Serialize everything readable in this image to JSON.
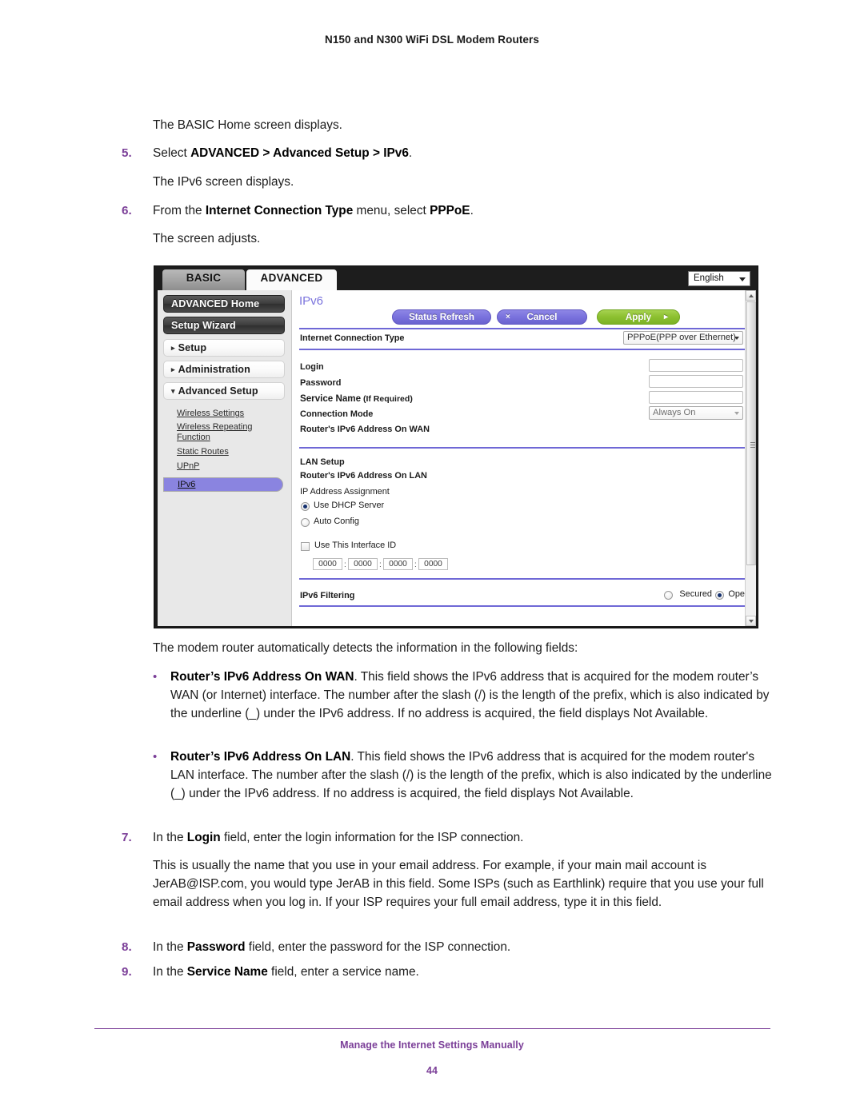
{
  "document": {
    "header_title": "N150 and N300 WiFi DSL Modem Routers",
    "footer_title": "Manage the Internet Settings Manually",
    "page_number": "44"
  },
  "body": {
    "intro_line": "The BASIC Home screen displays.",
    "step5": {
      "num": "5.",
      "pre": "Select ",
      "bold": "ADVANCED > Advanced Setup > IPv6",
      "post": "."
    },
    "after5": "The IPv6 screen displays.",
    "step6": {
      "num": "6.",
      "pre": "From the ",
      "bold": "Internet Connection Type",
      "mid": " menu, select ",
      "bold2": "PPPoE",
      "post": "."
    },
    "after6": "The screen adjusts.",
    "detects_line": "The modem router automatically detects the information in the following fields:",
    "bullet_wan": {
      "dot": "•",
      "bold": "Router’s IPv6 Address On WAN",
      "text": ". This field shows the IPv6 address that is acquired for the modem router’s WAN (or Internet) interface. The number after the slash (/) is the length of the prefix, which is also indicated by the underline (_) under the IPv6 address. If no address is acquired, the field displays Not Available."
    },
    "bullet_lan": {
      "dot": "•",
      "bold": "Router’s IPv6 Address On LAN",
      "text": ". This field shows the IPv6 address that is acquired for the modem router's LAN interface. The number after the slash (/) is the length of the prefix, which is also indicated by the underline (_) under the IPv6 address. If no address is acquired, the field displays Not Available."
    },
    "step7": {
      "num": "7.",
      "pre": "In the ",
      "bold": "Login",
      "post": " field, enter the login information for the ISP connection."
    },
    "after7": "This is usually the name that you use in your email address. For example, if your main mail account is JerAB@ISP.com, you would type JerAB in this field. Some ISPs (such as Earthlink) require that you use your full email address when you log in. If your ISP requires your full email address, type it in this field.",
    "step8": {
      "num": "8.",
      "pre": "In the ",
      "bold": "Password",
      "post": " field, enter the password for the ISP connection."
    },
    "step9": {
      "num": "9.",
      "pre": "In the ",
      "bold": "Service Name",
      "post": " field, enter a service name."
    }
  },
  "router_ui": {
    "tabs": {
      "basic": "BASIC",
      "advanced": "ADVANCED"
    },
    "language": {
      "value": "English"
    },
    "sidebar": {
      "advanced_home": "ADVANCED Home",
      "setup_wizard": "Setup Wizard",
      "setup": "Setup",
      "administration": "Administration",
      "advanced_setup": "Advanced Setup",
      "collapsed_arrow": "▸",
      "expanded_arrow": "▾",
      "links": [
        "Wireless Settings",
        "Wireless Repeating",
        "Function",
        "Static Routes",
        "UPnP"
      ],
      "selected_link": "IPv6"
    },
    "panel": {
      "title": "IPv6",
      "buttons": {
        "status_refresh": "Status Refresh",
        "cancel": "Cancel",
        "cancel_glyph": "×",
        "apply": "Apply",
        "apply_glyph": "▸"
      },
      "internet_connection_type_label": "Internet Connection Type",
      "internet_connection_type_value": "PPPoE(PPP over Ethernet)",
      "login_label": "Login",
      "login_value": "",
      "password_label": "Password",
      "password_value": "",
      "service_name_label": "Service Name",
      "service_name_suffix": " (If Required)",
      "service_name_value": "",
      "connection_mode_label": "Connection Mode",
      "connection_mode_value": "Always On",
      "wan_address_label": "Router's IPv6 Address On WAN",
      "lan_setup_label": "LAN Setup",
      "lan_address_label": "Router's IPv6 Address On LAN",
      "ip_assignment_label": "IP Address Assignment",
      "radio_use_dhcp": "Use DHCP Server",
      "radio_auto_config": "Auto Config",
      "checkbox_interface_id": "Use This Interface ID",
      "interface_id": [
        "0000",
        "0000",
        "0000",
        "0000"
      ],
      "interface_id_sep": ":",
      "ipv6_filtering_label": "IPv6 Filtering",
      "filter_secured": "Secured",
      "filter_open": "Open"
    }
  },
  "colors": {
    "accent_purple": "#7b3f98",
    "ui_purple": "#6f68d6",
    "ui_green": "#8cc02f",
    "sidebar_select": "#8a84e0"
  }
}
